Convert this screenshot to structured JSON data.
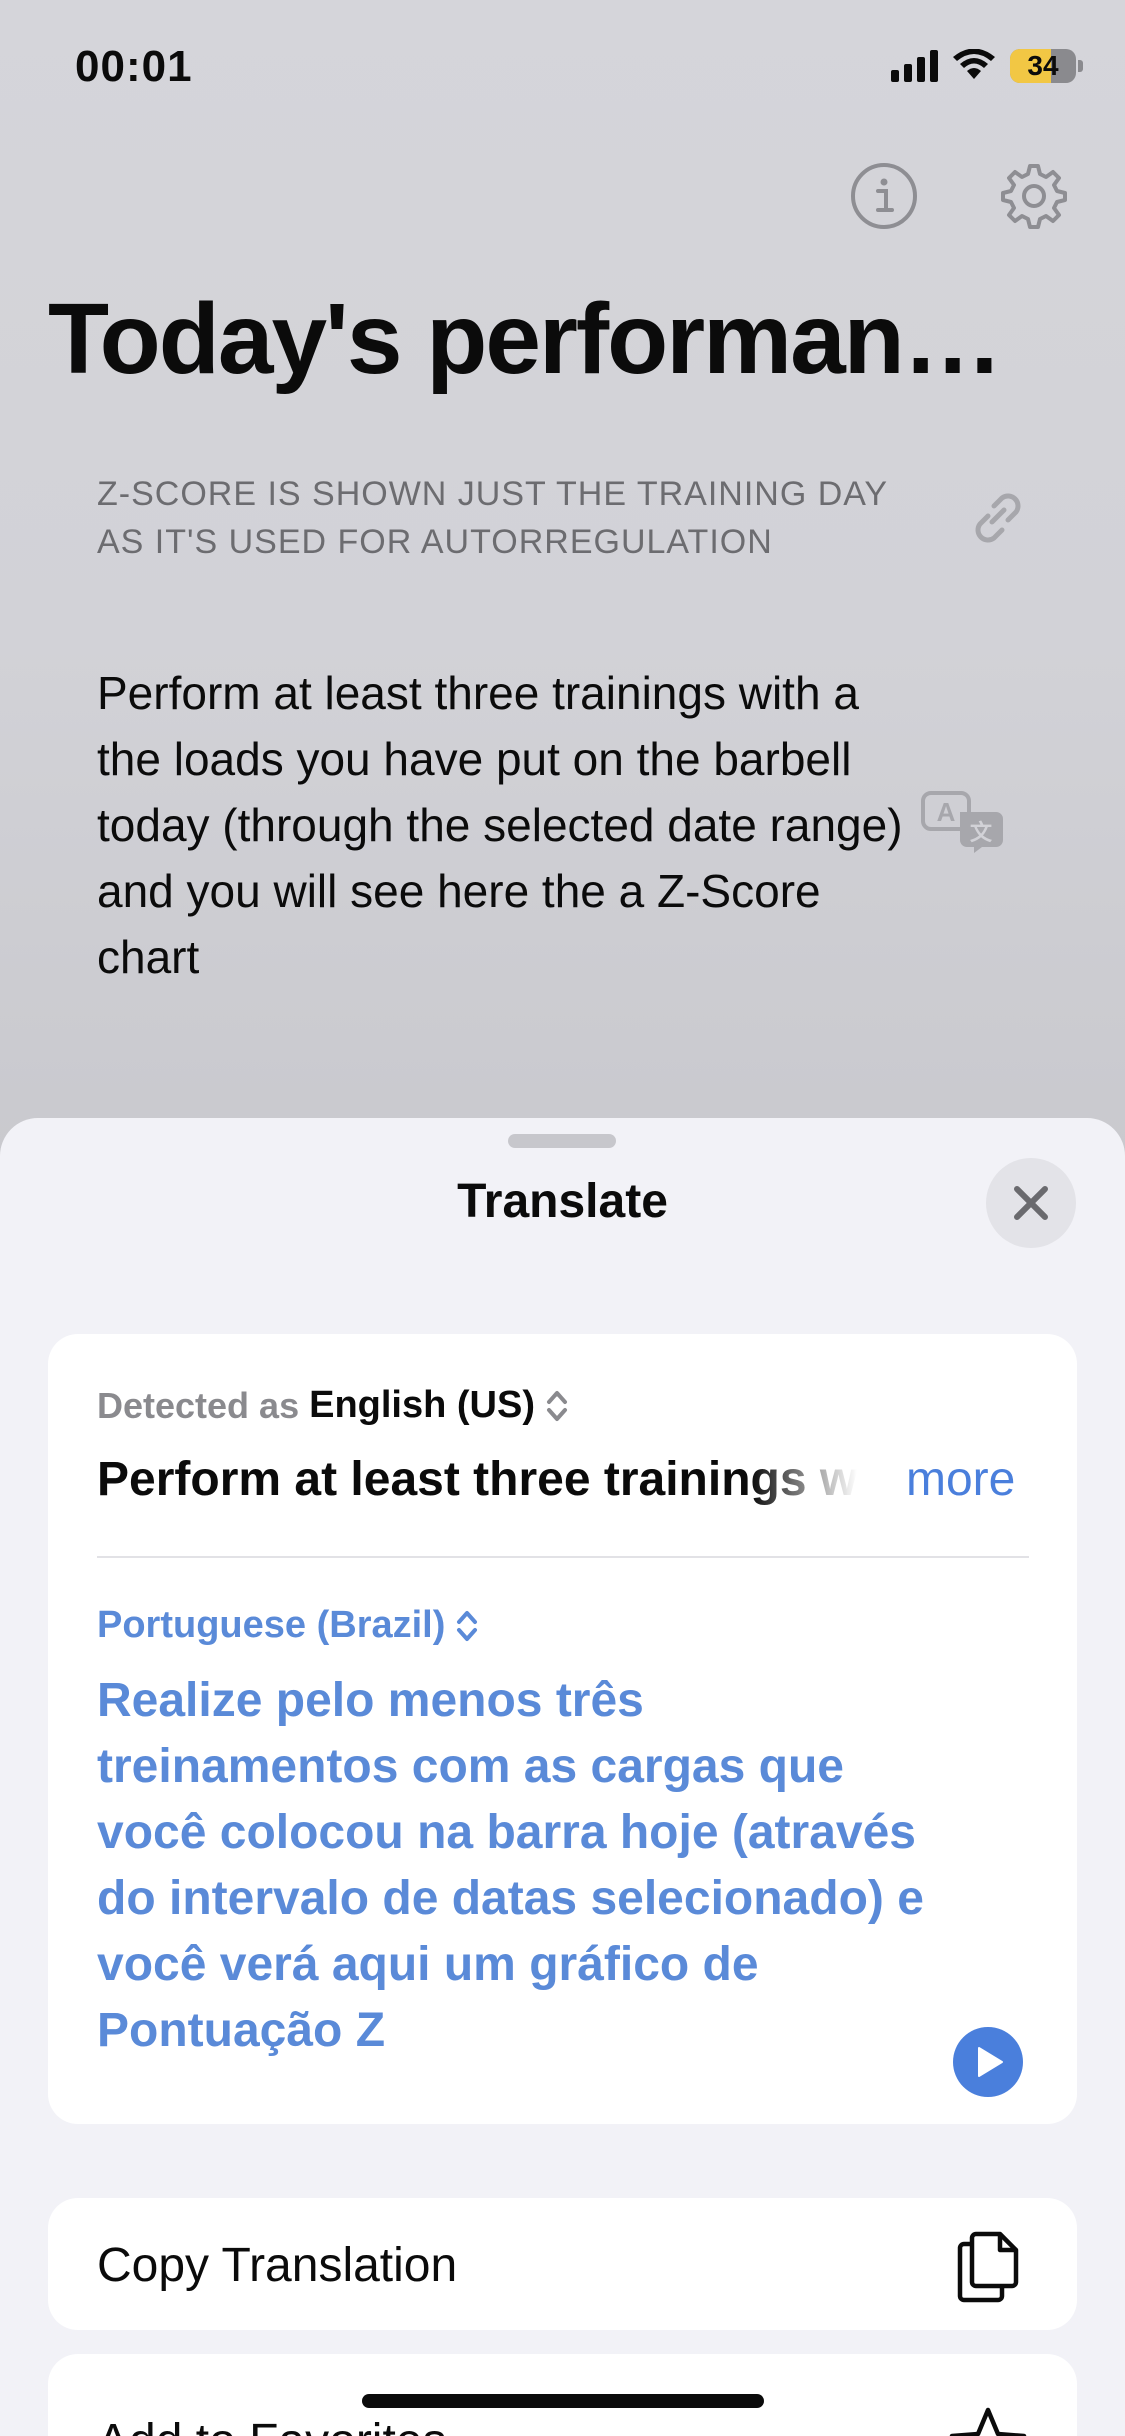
{
  "status_bar": {
    "time": "00:01",
    "battery_level": "34"
  },
  "header": {
    "info_icon": "info-icon",
    "settings_icon": "gear-icon",
    "title": "Today's performan…"
  },
  "content": {
    "zscore_note": "Z-SCORE IS SHOWN JUST THE TRAINING DAY AS IT'S USED FOR AUTORREGULATION",
    "link_icon": "link-icon",
    "message": "Perform at least three trainings with a the loads you have put on the barbell today (through the selected date range) and you will see here the a Z-Score chart",
    "translate_icon": "translate-icon"
  },
  "translate_sheet": {
    "title": "Translate",
    "close_icon": "close-icon",
    "source": {
      "detected_label": "Detected as",
      "language": "English (US)",
      "text": "Perform at least three trainings with a the loads you have put on the barbell today (through the selected date range) and you will see here the a Z-Score chart",
      "more_label": "more"
    },
    "target": {
      "language": "Portuguese (Brazil)",
      "text": "Realize pelo menos três treinamentos com as cargas que você colocou na barra hoje (através do intervalo de datas selecionado) e você verá aqui um gráfico de Pontuação Z"
    },
    "actions": [
      {
        "label": "Copy Translation",
        "icon": "copy-icon"
      },
      {
        "label": "Add to Favorites",
        "icon": "star-icon"
      }
    ]
  },
  "colors": {
    "accent": "#4a7fdc",
    "translation_text": "#5a8ad8",
    "sheet_background": "#f2f2f7",
    "battery_fill": "#f2c744"
  }
}
